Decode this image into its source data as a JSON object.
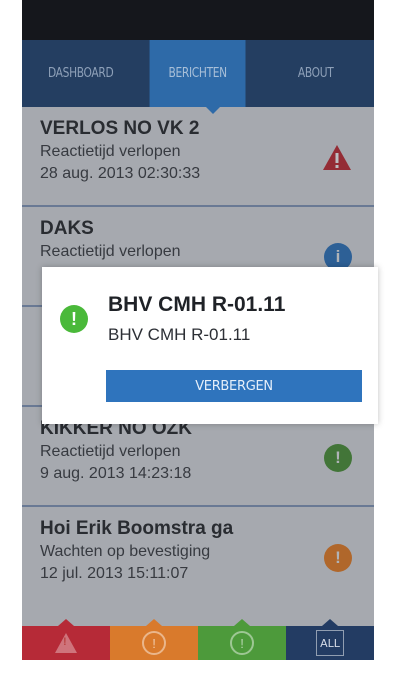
{
  "nav": {
    "tabs": [
      {
        "label": "DASHBOARD"
      },
      {
        "label": "BERICHTEN"
      },
      {
        "label": "ABOUT"
      }
    ]
  },
  "messages": [
    {
      "title": "VERLOS NO VK 2",
      "status": "Reactietijd verlopen",
      "time": "28 aug. 2013 02:30:33",
      "icon": "warning-icon",
      "color": "#b32c36"
    },
    {
      "title": "DAKS",
      "status": "Reactietijd verlopen",
      "time": "",
      "icon": "info-icon",
      "color": "#2f6fb3"
    },
    {
      "title": "",
      "status": "",
      "time": "",
      "icon": "",
      "color": ""
    },
    {
      "title": "KIKKER NO OZK",
      "status": "Reactietijd verlopen",
      "time": "9 aug. 2013 14:23:18",
      "icon": "exclamation-icon",
      "color": "#4a8a3a"
    },
    {
      "title": "Hoi Erik Boomstra ga",
      "status": "Wachten op bevestiging",
      "time": "12 jul. 2013 15:11:07",
      "icon": "exclamation-icon",
      "color": "#d6782a"
    }
  ],
  "dialog": {
    "icon": "exclamation-icon",
    "title": "BHV CMH R-01.11",
    "subtitle": "BHV CMH R-01.11",
    "button_label": "VERBERGEN"
  },
  "tabbar": {
    "items": [
      {
        "icon": "warning-icon",
        "color": "#b62a37"
      },
      {
        "icon": "exclamation-icon",
        "color": "#d97a2c"
      },
      {
        "icon": "exclamation-icon",
        "color": "#4d9a3b"
      },
      {
        "icon": "all-icon",
        "label": "ALL",
        "color": "#233c63"
      }
    ]
  },
  "colors": {
    "nav_bg": "#243e61",
    "nav_active": "#2e6aa8",
    "button": "#2f74bd"
  }
}
